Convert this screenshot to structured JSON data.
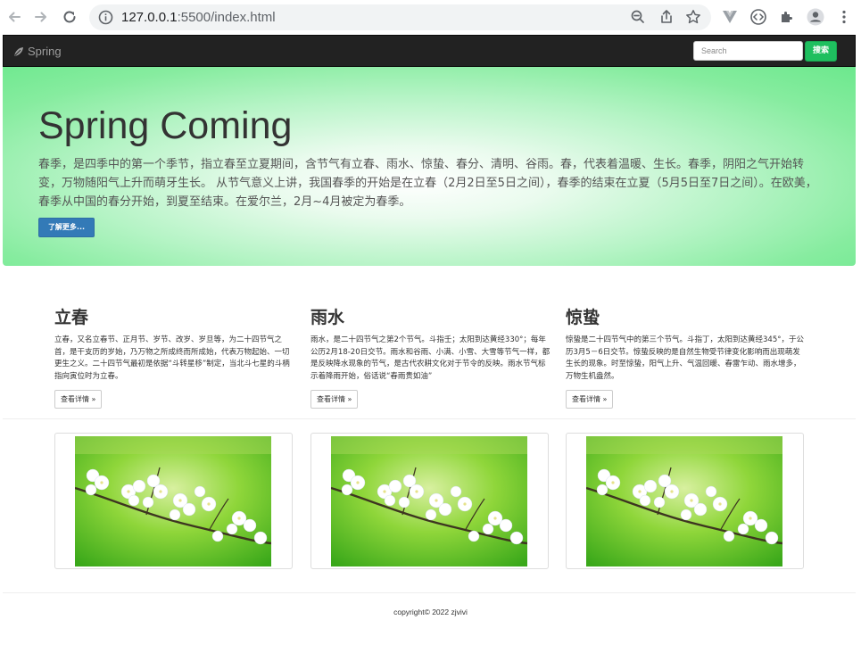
{
  "browser": {
    "url_host": "127.0.0.1",
    "url_rest": ":5500/index.html"
  },
  "navbar": {
    "brand": "Spring",
    "search_placeholder": "Search",
    "search_button": "搜索"
  },
  "jumbotron": {
    "title": "Spring Coming",
    "text": "春季，是四季中的第一个季节，指立春至立夏期间，含节气有立春、雨水、惊蛰、春分、清明、谷雨。春，代表着温暖、生长。春季，阴阳之气开始转变，万物随阳气上升而萌牙生长。 从节气意义上讲，我国春季的开始是在立春（2月2日至5日之间），春季的结束在立夏（5月5日至7日之间）。在欧美，春季从中国的春分开始，到夏至结束。在爱尔兰，2月~4月被定为春季。",
    "button": "了解更多..."
  },
  "columns": [
    {
      "title": "立春",
      "text": "立春，又名立春节、正月节、岁节、改岁、岁旦等，为二十四节气之首，是干支历的岁始，乃万物之所成终而所成始，代表万物起始、一切更生之义。二十四节气最初是依据“斗转星移”制定，当北斗七星的斗柄指向寅位时为立春。",
      "button": "查看详情 »"
    },
    {
      "title": "雨水",
      "text": "雨水，是二十四节气之第2个节气。斗指壬；太阳到达黄经330°；每年公历2月18-20日交节。雨水和谷雨、小满、小雪、大雪等节气一样，都是反映降水现象的节气，是古代农耕文化对于节令的反映。雨水节气标示着降雨开始，俗话说“春雨贵如油”",
      "button": "查看详情 »"
    },
    {
      "title": "惊蛰",
      "text": "惊蛰是二十四节气中的第三个节气。斗指丁，太阳到达黄经345°，于公历3月5－6日交节。惊蛰反映的是自然生物受节律变化影响而出现萌发生长的现象。时至惊蛰，阳气上升、气温回暖、春雷乍动、雨水增多，万物生机盎然。",
      "button": "查看详情 »"
    }
  ],
  "footer": "copyright© 2022 zjvivi"
}
